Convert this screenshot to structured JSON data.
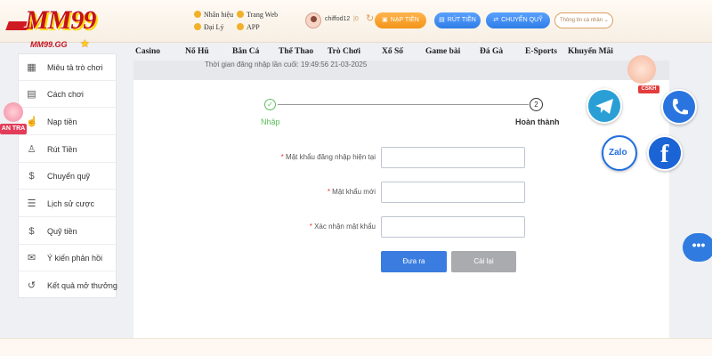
{
  "logo": {
    "main": "MM99",
    "sub": "MM99.GG"
  },
  "header": {
    "links": [
      {
        "label": "Nhân hiệu"
      },
      {
        "label": "Trang Web"
      },
      {
        "label": "Đại Lý"
      },
      {
        "label": "APP"
      }
    ],
    "username": "chiffod12",
    "balance": "|0",
    "buttons": {
      "deposit": "NẠP TIỀN",
      "withdraw": "RÚT TIỀN",
      "transfer": "CHUYỂN QUỸ"
    },
    "account_menu": "Thông tin cá nhân"
  },
  "nav": {
    "items": [
      "Casino",
      "Nổ Hũ",
      "Bắn Cá",
      "Thể Thao",
      "Trò Chơi",
      "Xổ Số",
      "Game bài",
      "Đá Gà",
      "E-Sports",
      "Khuyến Mãi"
    ]
  },
  "sidebar": {
    "items": [
      {
        "label": "Miêu tả trò chơi",
        "icon": "game-description-icon"
      },
      {
        "label": "Cách chơi",
        "icon": "how-to-play-icon"
      },
      {
        "label": "Nạp tiền",
        "icon": "deposit-icon"
      },
      {
        "label": "Rút Tiền",
        "icon": "withdraw-icon"
      },
      {
        "label": "Chuyển quỹ",
        "icon": "transfer-icon"
      },
      {
        "label": "Lịch sử cược",
        "icon": "bet-history-icon"
      },
      {
        "label": "Quỹ tiền",
        "icon": "funds-icon"
      },
      {
        "label": "Ý kiến phản hồi",
        "icon": "feedback-icon"
      },
      {
        "label": "Kết quả mở thưởng",
        "icon": "results-icon"
      }
    ]
  },
  "promo": {
    "tag": "AN TRA"
  },
  "last_login": "Thời gian đăng nhập lần cuối:   19:49:56 21-03-2025",
  "steps": {
    "step1_label": "Nhập",
    "step2_number": "2",
    "step2_label": "Hoàn thành"
  },
  "form": {
    "required_mark": "*",
    "fields": [
      {
        "label": "Mật khẩu đăng nhập hiện tại",
        "value": ""
      },
      {
        "label": "Mật khẩu mới",
        "value": ""
      },
      {
        "label": "Xác nhận mật khẩu",
        "value": ""
      }
    ],
    "submit": "Đưa ra",
    "reset": "Cài lại"
  },
  "support": {
    "cskh_tag": "CSKH",
    "zalo": "Zalo",
    "facebook": "f",
    "chat": "•••"
  },
  "colors": {
    "brand_red": "#c4121c",
    "primary_blue": "#3a7ce0",
    "deposit_orange": "#f29418",
    "success_green": "#5cbf5c"
  }
}
